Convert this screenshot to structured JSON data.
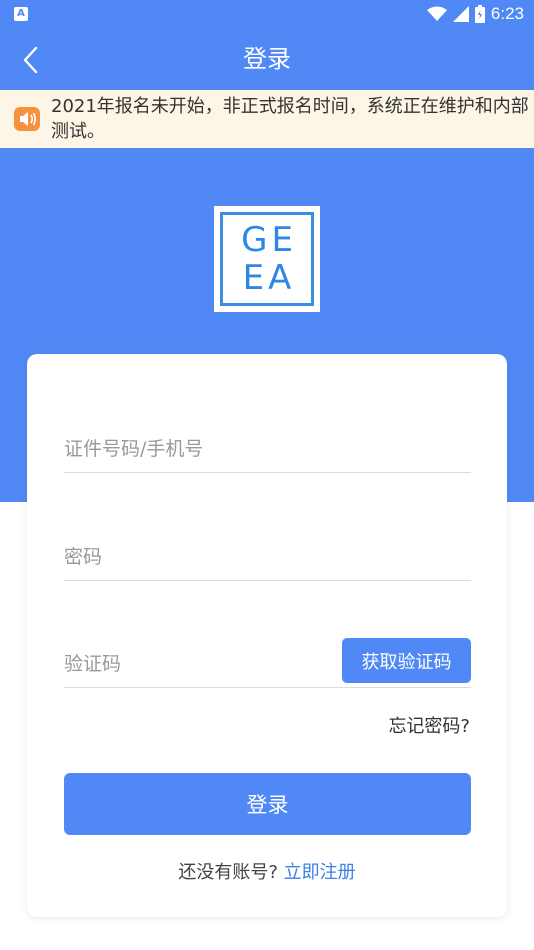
{
  "status_bar": {
    "left_icon_letter": "A",
    "time": "6:23",
    "icons": [
      "wifi-icon",
      "signal-icon",
      "battery-icon"
    ]
  },
  "nav": {
    "title": "登录",
    "back_icon": "chevron-left-icon"
  },
  "notice": {
    "icon": "speaker-icon",
    "text": "2021年报名未开始，非正式报名时间，系统正在维护和内部测试。"
  },
  "logo": {
    "row1": [
      "G",
      "E"
    ],
    "row2": [
      "E",
      "A"
    ]
  },
  "form": {
    "id_placeholder": "证件号码/手机号",
    "password_placeholder": "密码",
    "code_placeholder": "验证码",
    "get_code_label": "获取验证码",
    "forgot_label": "忘记密码?",
    "login_label": "登录",
    "register_prompt": "还没有账号?",
    "register_link": "立即注册"
  },
  "colors": {
    "primary": "#5089f5",
    "notice_bg": "#fdf5e6",
    "notice_icon": "#f5923e",
    "link": "#3e7fe8"
  }
}
